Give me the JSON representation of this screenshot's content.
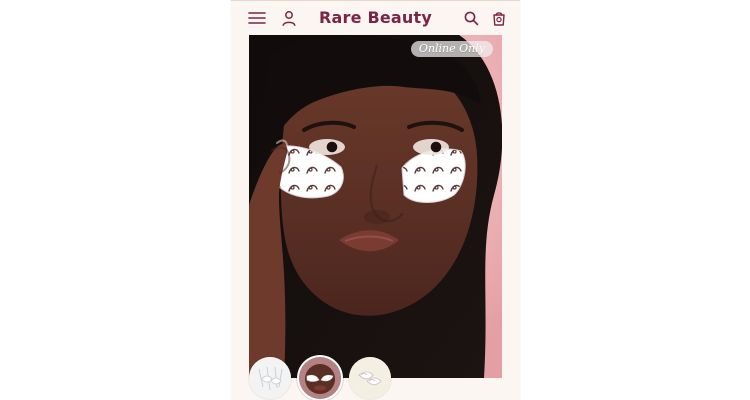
{
  "header": {
    "brand_name": "Rare Beauty",
    "icons": {
      "menu": "hamburger-menu-icon",
      "account": "user-icon",
      "search": "search-icon",
      "bag": "shopping-bag-icon"
    }
  },
  "hero": {
    "badge_text": "Online Only",
    "background_color": "#ebb0b3"
  },
  "thumbnails": [
    {
      "name": "thumbnail-product-diagram",
      "selected": false
    },
    {
      "name": "thumbnail-model-eye-patches",
      "selected": true
    },
    {
      "name": "thumbnail-eye-patches-closeup",
      "selected": false
    }
  ],
  "colors": {
    "brand": "#7a2446",
    "page_background": "#fbf6f2"
  }
}
